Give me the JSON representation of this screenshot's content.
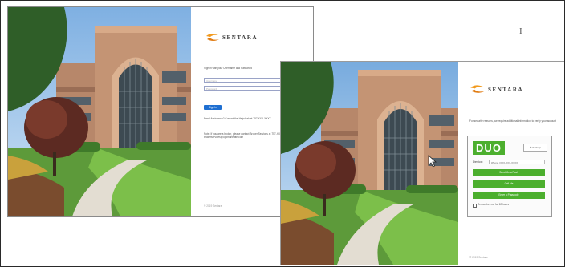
{
  "brand": {
    "name": "SENTARA",
    "accent": "#f29a1e"
  },
  "login_window": {
    "prompt": "Sign in with your Username and Password",
    "username_placeholder": "Username",
    "password_placeholder": "Password",
    "signin_label": "Sign In",
    "help_text": "Need Assistance? Contact the Helpdesk at 757-XXX-XXXX.",
    "note_text": "Note: If you are a broker, please contact Broker Services at 757-XXX-XXXX or brokerservices@optimahealth.com",
    "footer": "© 2019 Sentara"
  },
  "duo_window": {
    "prompt": "For security reasons, we require additional information to verify your account",
    "duo_logo": "DUO",
    "settings_label": "⚙ Settings",
    "device_label": "Device:",
    "device_value": "iPhone (XXX-XXX-XXXX)",
    "buttons": [
      "Send Me a Push",
      "Call Me",
      "Enter a Passcode"
    ],
    "remember_label": "Remember me for 12 hours",
    "footer": "© 2019 Sentara"
  },
  "icons": {
    "text_cursor": "I",
    "mouse_pointer": "pointer-icon"
  }
}
